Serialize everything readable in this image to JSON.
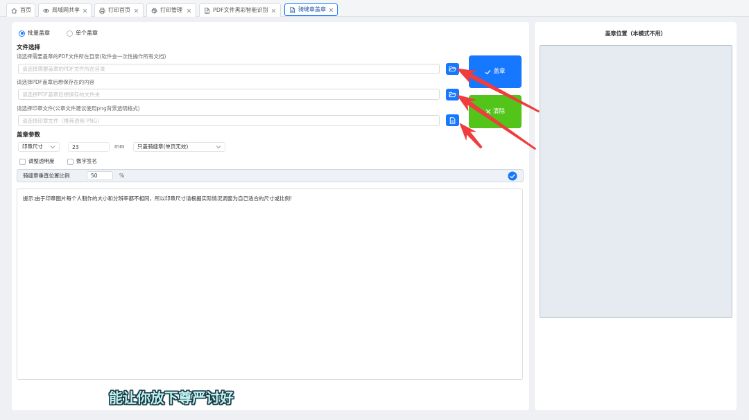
{
  "colors": {
    "accent": "#1677ff",
    "success": "#52c41a",
    "annotation": "#f03c3c",
    "page_background": "#eef0f4",
    "preview_background": "#e6ebf1"
  },
  "tabs": [
    {
      "label": "首页",
      "icon": "home-icon",
      "closable": false,
      "active": false
    },
    {
      "label": "局域网共享",
      "icon": "eye-icon",
      "closable": true,
      "active": false
    },
    {
      "label": "打印首页",
      "icon": "printer-icon",
      "closable": true,
      "active": false
    },
    {
      "label": "打印管理",
      "icon": "gear-icon",
      "closable": true,
      "active": false
    },
    {
      "label": "PDF文件黑彩智能识别",
      "icon": "document-icon",
      "closable": true,
      "active": false
    },
    {
      "label": "骑缝章盖章",
      "icon": "document-icon",
      "closable": true,
      "active": true
    }
  ],
  "mode": {
    "options": [
      {
        "label": "批量盖章",
        "checked": true
      },
      {
        "label": "单个盖章",
        "checked": false
      }
    ]
  },
  "file_selection": {
    "title": "文件选择",
    "source_dir": {
      "label": "请选择需要盖章的PDF文件所在目录(软件会一次性操作所有文档)",
      "placeholder": "请选择需要盖章的PDF文件所在目录",
      "value": "",
      "button_icon": "folder-open-icon"
    },
    "output_dir": {
      "label": "请选择PDF盖章后想保存在的内容",
      "placeholder": "请选择PDF盖章后想保存的文件夹",
      "value": "",
      "button_icon": "folder-open-icon"
    },
    "seal_file": {
      "label": "请选择印章文件(公章文件建议使用png背景透明格式)",
      "placeholder": "请选择印章文件（推荐透明 PNG）",
      "value": "",
      "button_icon": "file-icon"
    }
  },
  "actions": {
    "stamp": {
      "label": "盖章",
      "icon": "check-icon"
    },
    "clear": {
      "label": "清除",
      "icon": "close-icon"
    }
  },
  "params": {
    "title": "盖章参数",
    "size_mode": "印章尺寸",
    "size_value": "23",
    "size_unit": "mm",
    "stamp_type": "只盖骑缝章(单页无效)",
    "adjust_opacity": {
      "label": "调整透明度",
      "checked": false
    },
    "digital_signature": {
      "label": "数字签名",
      "checked": false
    },
    "vertical_ratio": {
      "label": "骑缝章垂直位置比例",
      "value": "50",
      "unit": "%",
      "confirmed": true
    }
  },
  "tip": "提示:由于印章图片每个人制作的大小和分辨率都不相同，所以印章尺寸请根据实际情况调整为自己适合的尺寸或比例!",
  "preview": {
    "title": "盖章位置（本模式不用）"
  },
  "subtitle": "能让你放下尊严讨好"
}
